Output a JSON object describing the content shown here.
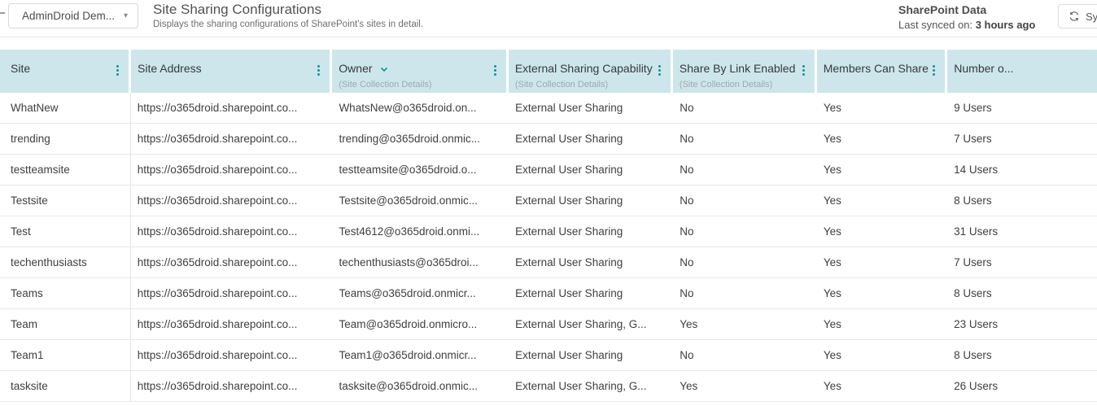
{
  "colors": {
    "accent_teal": "#0f939b",
    "header_bg": "#cde6ec"
  },
  "topbar": {
    "tenant_selector": {
      "label": "AdminDroid Dem...",
      "caret": "▾"
    },
    "page_title": "Site Sharing Configurations",
    "page_subtitle": "Displays the sharing configurations of SharePoint's sites in detail.",
    "data_source": {
      "name": "SharePoint Data",
      "last_synced_label": "Last synced on:",
      "last_synced_value": "3 hours ago"
    },
    "sync_button": {
      "label": "Sync",
      "icon": "sync-icon"
    }
  },
  "table": {
    "columns": [
      {
        "label": "Site",
        "sublabel": "",
        "has_menu": true,
        "sorted": false
      },
      {
        "label": "Site Address",
        "sublabel": "",
        "has_menu": true,
        "sorted": false
      },
      {
        "label": "Owner",
        "sublabel": "(Site Collection Details)",
        "has_menu": true,
        "sorted": true
      },
      {
        "label": "External Sharing Capability",
        "sublabel": "(Site Collection Details)",
        "has_menu": true,
        "sorted": false
      },
      {
        "label": "Share By Link Enabled",
        "sublabel": "(Site Collection Details)",
        "has_menu": true,
        "sorted": false
      },
      {
        "label": "Members Can Share",
        "sublabel": "",
        "has_menu": true,
        "sorted": false
      },
      {
        "label": "Number o...",
        "sublabel": "",
        "has_menu": false,
        "sorted": false
      }
    ],
    "rows": [
      [
        "WhatNew",
        "https://o365droid.sharepoint.co...",
        "WhatsNew@o365droid.on...",
        "External User Sharing",
        "No",
        "Yes",
        "9 Users"
      ],
      [
        "trending",
        "https://o365droid.sharepoint.co...",
        "trending@o365droid.onmic...",
        "External User Sharing",
        "No",
        "Yes",
        "7 Users"
      ],
      [
        "testteamsite",
        "https://o365droid.sharepoint.co...",
        "testteamsite@o365droid.o...",
        "External User Sharing",
        "No",
        "Yes",
        "14 Users"
      ],
      [
        "Testsite",
        "https://o365droid.sharepoint.co...",
        "Testsite@o365droid.onmic...",
        "External User Sharing",
        "No",
        "Yes",
        "8 Users"
      ],
      [
        "Test",
        "https://o365droid.sharepoint.co...",
        "Test4612@o365droid.onmi...",
        "External User Sharing",
        "No",
        "Yes",
        "31 Users"
      ],
      [
        "techenthusiasts",
        "https://o365droid.sharepoint.co...",
        "techenthusiasts@o365droi...",
        "External User Sharing",
        "No",
        "Yes",
        "7 Users"
      ],
      [
        "Teams",
        "https://o365droid.sharepoint.co...",
        "Teams@o365droid.onmicr...",
        "External User Sharing",
        "No",
        "Yes",
        "8 Users"
      ],
      [
        "Team",
        "https://o365droid.sharepoint.co...",
        "Team@o365droid.onmicro...",
        "External User Sharing, G...",
        "Yes",
        "Yes",
        "23 Users"
      ],
      [
        "Team1",
        "https://o365droid.sharepoint.co...",
        "Team1@o365droid.onmicr...",
        "External User Sharing",
        "No",
        "Yes",
        "8 Users"
      ],
      [
        "tasksite",
        "https://o365droid.sharepoint.co...",
        "tasksite@o365droid.onmic...",
        "External User Sharing, G...",
        "Yes",
        "Yes",
        "26 Users"
      ]
    ]
  }
}
